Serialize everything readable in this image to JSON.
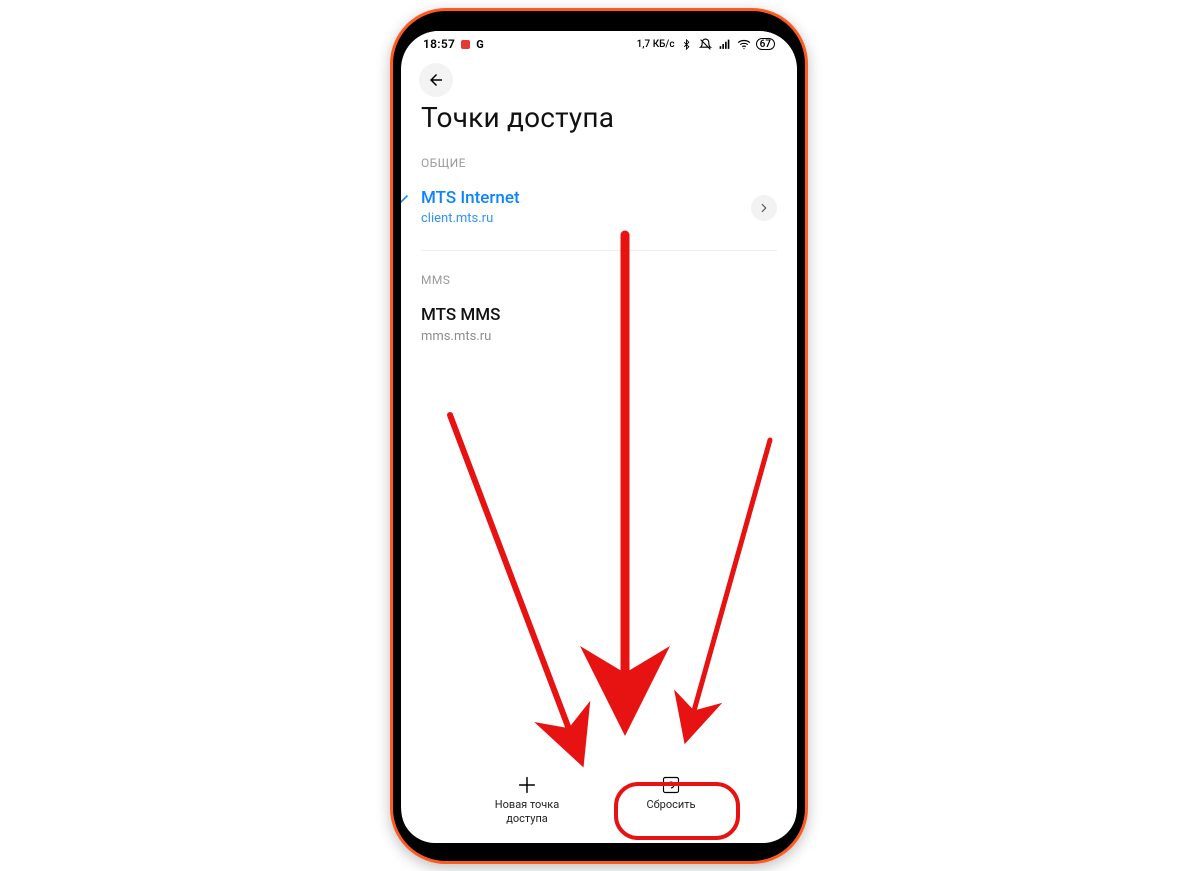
{
  "statusbar": {
    "time": "18:57",
    "g": "G",
    "net_speed": "1,7 КБ/с",
    "battery": "67"
  },
  "page": {
    "title": "Точки доступа",
    "sections": {
      "general": {
        "label": "ОБЩИЕ"
      },
      "mms": {
        "label": "MMS"
      }
    }
  },
  "apns": {
    "internet": {
      "title": "MTS Internet",
      "sub": "client.mts.ru"
    },
    "mms": {
      "title": "MTS MMS",
      "sub": "mms.mts.ru"
    }
  },
  "bottom": {
    "new_apn": {
      "label_line1": "Новая точка",
      "label_line2": "доступа"
    },
    "reset": {
      "label": "Сбросить"
    }
  },
  "icons": {
    "back": "back-arrow-icon",
    "chevron": "chevron-right-icon",
    "check": "check-icon",
    "plus": "plus-icon",
    "reset": "reset-icon",
    "bluetooth": "bluetooth-icon",
    "dnd": "do-not-disturb-icon",
    "signal": "signal-icon",
    "wifi": "wifi-icon",
    "battery": "battery-icon"
  },
  "annotation": "Three red arrows pointing to Reset button, which is circled in red"
}
